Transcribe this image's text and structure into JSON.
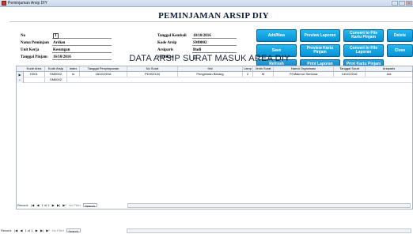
{
  "window": {
    "title": "Peminjaman Arsip DIY"
  },
  "form": {
    "title": "PEMINJAMAN ARSIP DIY",
    "fields": {
      "no": {
        "label": "No",
        "value": "1"
      },
      "nama_peminjam": {
        "label": "Nama Peminjam",
        "value": "Ardian"
      },
      "unit_kerja": {
        "label": "Unit Kerja",
        "value": "Kesungan"
      },
      "tanggal_pinjam": {
        "label": "Tanggal Pinjam",
        "value": "16/10/2016"
      },
      "tanggal_kembali": {
        "label": "Tanggal Kembali",
        "value": "18/10/2016"
      },
      "kode_arsip": {
        "label": "Kode Arsip",
        "value": "SM0002"
      },
      "arsiparis": {
        "label": "Arsiparis",
        "value": "Budi"
      },
      "verifikasi": {
        "label": "Verifikasi",
        "checked": true
      }
    }
  },
  "buttons": {
    "add_new": "Add/New",
    "preview_laporan": "Preview Laporan",
    "convert_kartu": "Convert to File\nKartu Pinjam",
    "delete": "Delete",
    "save": "Save",
    "preview_kartu": "Preview Kartu\nPinjam",
    "convert_laporan": "Convert to File\nLaporan",
    "close": "Close",
    "refresh": "Refresh",
    "print_laporan": "Print Laporan",
    "print_kartu": "Print Kartu Pinjam"
  },
  "grid": {
    "title": "DATA ARSIP SURAT MASUK AREA DIY",
    "columns": [
      "Kode Area",
      "Kode Arsip",
      "Index",
      "Tanggal Penyimpanan",
      "No Surat",
      "Hal",
      "Lamp",
      "Jenis Surat",
      "Nama Organisasi",
      "Tanggal Surat",
      "Arsiparis"
    ],
    "rows": [
      {
        "selector": "▶",
        "cells": [
          "D001",
          "SM0002",
          "In",
          "18/10/2016",
          "PD/02/134",
          "Pengiriman Barang",
          "2",
          "M",
          "Pt.Makmur Sentosa",
          "14/10/2016",
          "Adi"
        ]
      },
      {
        "selector": "*",
        "cells": [
          "",
          "SM0002",
          "",
          "",
          "",
          "",
          "",
          "",
          "",
          "",
          ""
        ]
      }
    ],
    "navigator": {
      "record_label": "Record:",
      "position": "1 of 1",
      "filter": "No Filter",
      "search": "Search"
    }
  },
  "outer_navigator": {
    "record_label": "Record:",
    "position": "1 of 1",
    "filter": "No Filter",
    "search": "Search"
  }
}
